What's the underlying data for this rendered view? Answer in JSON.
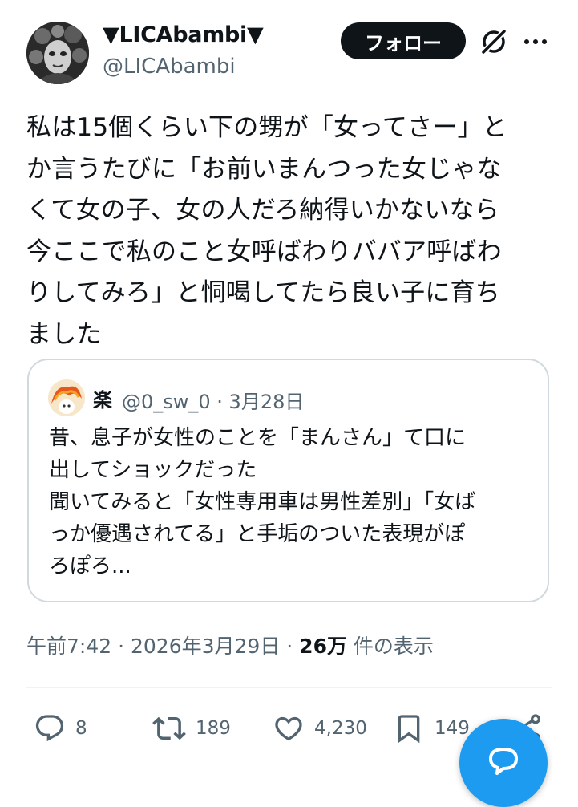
{
  "author": {
    "display_name": "▼LICAbambi▼",
    "handle": "@LICAbambi"
  },
  "header": {
    "follow_label": "フォロー"
  },
  "tweet": {
    "text": "私は15個くらい下の甥が「女ってさー」と\nか言うたびに「お前いまんつった女じゃな\nくて女の子、女の人だろ納得いかないなら\n今ここで私のこと女呼ばわりババア呼ばわ\nりしてみろ」と恫喝してたら良い子に育ち\nました"
  },
  "quote": {
    "name": "楽",
    "handle_date": "@0_sw_0 · 3月28日",
    "text": "昔、息子が女性のことを「まんさん」て口に\n出してショックだった\n聞いてみると「女性専用車は男性差別」「女ば\nっか優遇されてる」と手垢のついた表現がぽ\nろぽろ..."
  },
  "meta": {
    "time_date": "午前7:42 · 2026年3月29日 · ",
    "views_count": "26万",
    "views_label": " 件の表示"
  },
  "actions": {
    "replies": "8",
    "reposts": "189",
    "likes": "4,230",
    "bookmarks": "149"
  },
  "icons": {
    "reply": "reply-icon",
    "repost": "repost-icon",
    "like": "heart-icon",
    "bookmark": "bookmark-icon",
    "share": "share-icon",
    "grok": "grok-icon",
    "more": "more-icon",
    "compose": "compose-icon"
  },
  "colors": {
    "text": "#0f1419",
    "secondary": "#536471",
    "accent": "#1d9bf0",
    "border": "#cfd9de"
  }
}
